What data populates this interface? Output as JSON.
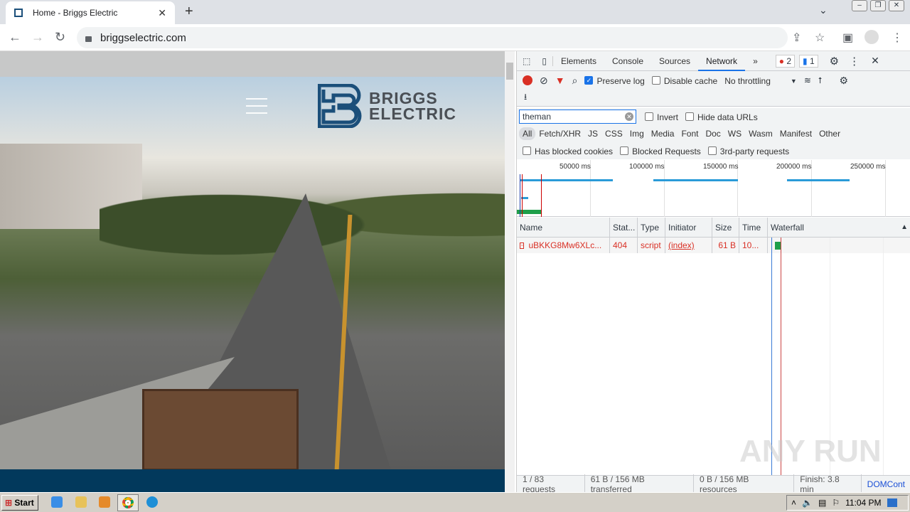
{
  "browser": {
    "tab_title": "Home - Briggs Electric",
    "url": "briggselectric.com"
  },
  "site": {
    "logo_line1": "BRIGGS",
    "logo_line2": "ELECTRIC"
  },
  "devtools": {
    "tabs": [
      "Elements",
      "Console",
      "Sources",
      "Network"
    ],
    "more": "»",
    "errors": "2",
    "messages": "1",
    "preserve_log": "Preserve log",
    "preserve_log_checked": true,
    "disable_cache": "Disable cache",
    "throttling": "No throttling",
    "filter_value": "theman",
    "invert": "Invert",
    "hide_data_urls": "Hide data URLs",
    "types": [
      "All",
      "Fetch/XHR",
      "JS",
      "CSS",
      "Img",
      "Media",
      "Font",
      "Doc",
      "WS",
      "Wasm",
      "Manifest",
      "Other"
    ],
    "blocked": [
      "Has blocked cookies",
      "Blocked Requests",
      "3rd-party requests"
    ],
    "ticks": [
      "50000 ms",
      "100000 ms",
      "150000 ms",
      "200000 ms",
      "250000 ms"
    ],
    "columns": [
      "Name",
      "Stat...",
      "Type",
      "Initiator",
      "Size",
      "Time",
      "Waterfall"
    ],
    "rows": [
      {
        "name": "uBKKG8Mw6XLc...",
        "status": "404",
        "type": "script",
        "initiator": "(index)",
        "size": "61 B",
        "time": "10..."
      }
    ],
    "status": [
      "1 / 83 requests",
      "61 B / 156 MB transferred",
      "0 B / 156 MB resources",
      "Finish: 3.8 min",
      "DOMCont"
    ]
  },
  "taskbar": {
    "start": "Start",
    "clock": "11:04 PM"
  },
  "watermark": "ANY RUN"
}
